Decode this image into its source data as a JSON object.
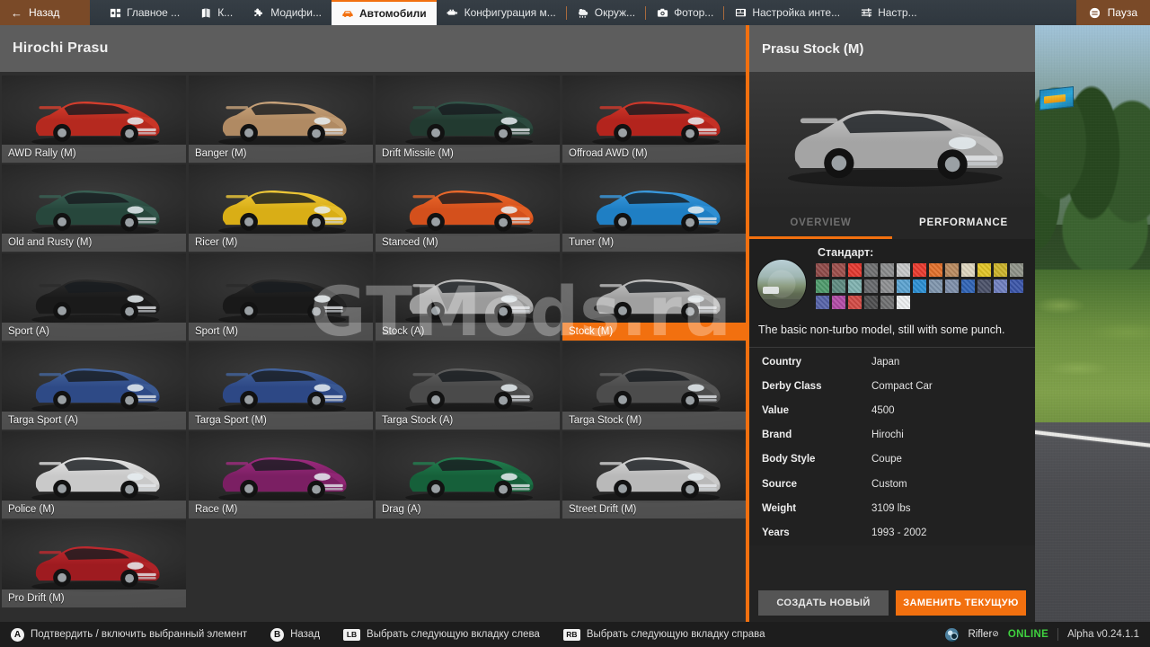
{
  "topbar": {
    "back_label": "Назад",
    "back_icon": "arrow-left-icon",
    "tabs": [
      {
        "label": "Главное ...",
        "icon": "dashboard-icon",
        "active": false
      },
      {
        "label": "К...",
        "icon": "map-icon",
        "active": false
      },
      {
        "label": "Модифи...",
        "icon": "puzzle-icon",
        "active": false
      },
      {
        "label": "Автомобили",
        "icon": "car-icon",
        "active": true
      },
      {
        "label": "Конфигурация м...",
        "icon": "engine-icon",
        "active": false
      },
      {
        "label": "Окруж...",
        "icon": "weather-icon",
        "active": false
      },
      {
        "label": "Фотор...",
        "icon": "camera-icon",
        "active": false
      },
      {
        "label": "Настройка инте...",
        "icon": "layout-icon",
        "active": false
      },
      {
        "label": "Настр...",
        "icon": "sliders-icon",
        "active": false
      }
    ],
    "pause_label": "Пауза",
    "pause_icon": "pause-menu-icon"
  },
  "left_panel": {
    "title": "Hirochi Prasu",
    "configs": [
      {
        "label": "AWD Rally (M)",
        "body": "#b5291f",
        "accent": "#d8402e",
        "selected": false
      },
      {
        "label": "Banger (M)",
        "body": "#b08a63",
        "accent": "#c9a47c",
        "selected": false
      },
      {
        "label": "Drift Missile (M)",
        "body": "#223a30",
        "accent": "#33564a",
        "selected": false
      },
      {
        "label": "Offroad AWD (M)",
        "body": "#b3241d",
        "accent": "#d23a2c",
        "selected": false
      },
      {
        "label": "Old and Rusty (M)",
        "body": "#27473c",
        "accent": "#3a6155",
        "selected": false
      },
      {
        "label": "Ricer (M)",
        "body": "#d9ae16",
        "accent": "#efc93a",
        "selected": false
      },
      {
        "label": "Stanced (M)",
        "body": "#d4501c",
        "accent": "#ec6a2c",
        "selected": false
      },
      {
        "label": "Tuner (M)",
        "body": "#1f7fc4",
        "accent": "#3b9ade",
        "selected": false
      },
      {
        "label": "Sport (A)",
        "body": "#1a1a1a",
        "accent": "#2c2c2c",
        "selected": false
      },
      {
        "label": "Sport (M)",
        "body": "#191919",
        "accent": "#2b2b2b",
        "selected": false
      },
      {
        "label": "Stock (A)",
        "body": "#9b9b9b",
        "accent": "#bdbdbd",
        "selected": false
      },
      {
        "label": "Stock (M)",
        "body": "#a0a0a0",
        "accent": "#c2c2c2",
        "selected": true
      },
      {
        "label": "Targa Sport (A)",
        "body": "#2e4a86",
        "accent": "#45669e",
        "selected": false
      },
      {
        "label": "Targa Sport (M)",
        "body": "#2d4885",
        "accent": "#44649d",
        "selected": false
      },
      {
        "label": "Targa Stock (A)",
        "body": "#4a4a4a",
        "accent": "#5f5f5f",
        "selected": false
      },
      {
        "label": "Targa Stock (M)",
        "body": "#4c4c4c",
        "accent": "#616161",
        "selected": false
      },
      {
        "label": "Police (M)",
        "body": "#c9c9c9",
        "accent": "#e4e4e4",
        "selected": false
      },
      {
        "label": "Race (M)",
        "body": "#7b1f63",
        "accent": "#a02c81",
        "selected": false
      },
      {
        "label": "Drag (A)",
        "body": "#16603a",
        "accent": "#238050",
        "selected": false
      },
      {
        "label": "Street Drift (M)",
        "body": "#b9b9b9",
        "accent": "#d6d6d6",
        "selected": false
      },
      {
        "label": "Pro Drift (M)",
        "body": "#9e1b20",
        "accent": "#bf2a2f",
        "selected": false
      }
    ]
  },
  "right_panel": {
    "title": "Prasu Stock (M)",
    "preview_body": "#a4a4a4",
    "preview_accent": "#c6c6c6",
    "tabs": [
      {
        "label": "OVERVIEW",
        "active": true
      },
      {
        "label": "PERFORMANCE",
        "active": false
      }
    ],
    "paint": {
      "section_label": "Стандарт:",
      "thumbnail_icon": "color-preview-thumbnail",
      "rows": [
        [
          "#8f4a48",
          "#9c4e4b",
          "#e5382f",
          "#6f7071",
          "#8a8b8c",
          "#c6c7c8",
          "#ea3a2e",
          "#e2702a",
          "#b98a5f",
          "#ded6c0",
          "#e2c425",
          "#ccb32a",
          "#8e9288"
        ],
        [
          "#4e9a6b",
          "#5d8a80",
          "#7fb2b0",
          "#67696c",
          "#8d8f91",
          "#5ba3d0",
          "#2b8fd3",
          "#7f95ad",
          "#7e8faa",
          "#2f63b5",
          "#4a5068",
          "#6f7fbf",
          "#3a55a8"
        ],
        [
          "#5663a8",
          "#b24ba6",
          "#d14a44",
          "#4c4c4d",
          "#6e6f70",
          "#eceff0"
        ]
      ]
    },
    "description": "The basic non-turbo model, still with some punch.",
    "specs": [
      {
        "key": "Country",
        "value": "Japan"
      },
      {
        "key": "Derby Class",
        "value": "Compact Car"
      },
      {
        "key": "Value",
        "value": "4500"
      },
      {
        "key": "Brand",
        "value": "Hirochi"
      },
      {
        "key": "Body Style",
        "value": "Coupe"
      },
      {
        "key": "Source",
        "value": "Custom"
      },
      {
        "key": "Weight",
        "value": "3109 lbs"
      },
      {
        "key": "Years",
        "value": "1993 - 2002"
      }
    ],
    "actions": {
      "secondary": "СОЗДАТЬ НОВЫЙ",
      "primary": "ЗАМЕНИТЬ ТЕКУЩУЮ"
    }
  },
  "watermark": "GTMods.ru",
  "bottombar": {
    "hints": [
      {
        "button": "A",
        "shape": "round",
        "label": "Подтвердить / включить выбранный элемент"
      },
      {
        "button": "B",
        "shape": "round",
        "label": "Назад"
      },
      {
        "button": "LB",
        "shape": "rect",
        "label": "Выбрать следующую вкладку слева"
      },
      {
        "button": "RB",
        "shape": "rect",
        "label": "Выбрать следующую вкладку справа"
      }
    ],
    "account_icon": "steam-icon",
    "account_name": "Rifler",
    "account_mark": "⊘",
    "status": "ONLINE",
    "status_color": "#3fd13f",
    "version": "Alpha v0.24.1.1"
  }
}
